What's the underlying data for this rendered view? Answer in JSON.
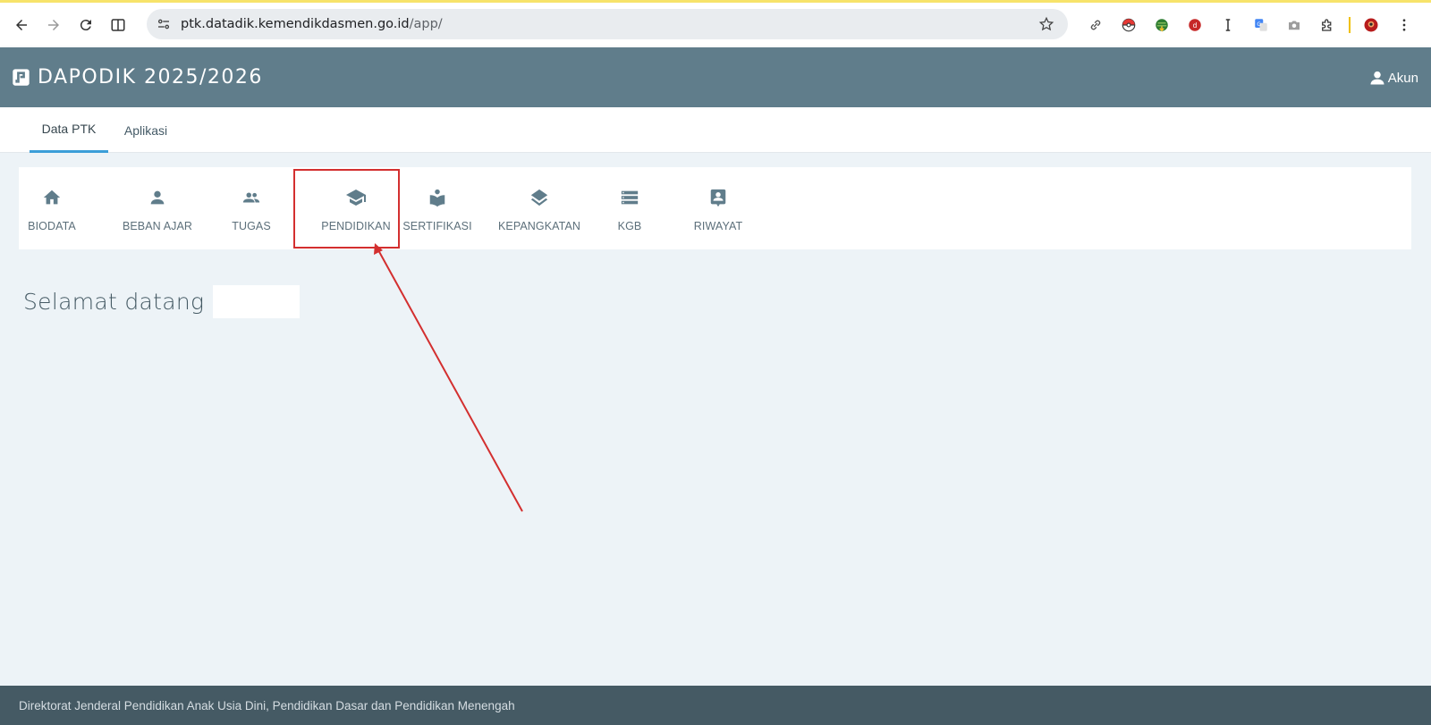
{
  "browser": {
    "url_host": "ptk.datadik.kemendikdasmen.go.id",
    "url_path": "/app/",
    "icons": [
      "back-icon",
      "forward-icon",
      "reload-icon",
      "split-view-icon",
      "site-settings-icon",
      "bookmark-star-icon",
      "link-icon",
      "pokeball-extension-icon",
      "idm-extension-icon",
      "red-extension-icon",
      "text-cursor-extension-icon",
      "translate-extension-icon",
      "camera-extension-icon",
      "extensions-puzzle-icon",
      "profile-avatar-icon",
      "kebab-menu-icon"
    ]
  },
  "header": {
    "title": "DAPODIK 2025/2026",
    "account_label": "Akun",
    "bg_color": "#607d8b"
  },
  "tabs": [
    {
      "label": "Data PTK",
      "active": true
    },
    {
      "label": "Aplikasi",
      "active": false
    }
  ],
  "menu": [
    {
      "label": "BIODATA",
      "icon": "home-icon"
    },
    {
      "label": "BEBAN AJAR",
      "icon": "person-icon"
    },
    {
      "label": "TUGAS",
      "icon": "people-icon"
    },
    {
      "label": "PENDIDIKAN",
      "icon": "graduation-cap-icon",
      "highlighted": true
    },
    {
      "label": "SERTIFIKASI",
      "icon": "reading-book-icon"
    },
    {
      "label": "KEPANGKATAN",
      "icon": "layers-icon"
    },
    {
      "label": "KGB",
      "icon": "list-storage-icon"
    },
    {
      "label": "RIWAYAT",
      "icon": "contact-badge-icon"
    }
  ],
  "welcome": {
    "text": "Selamat datang"
  },
  "footer": {
    "text": "Direktorat Jenderal Pendidikan Anak Usia Dini, Pendidikan Dasar dan Pendidikan Menengah"
  },
  "annotation": {
    "highlight_color": "#d32f2f"
  }
}
